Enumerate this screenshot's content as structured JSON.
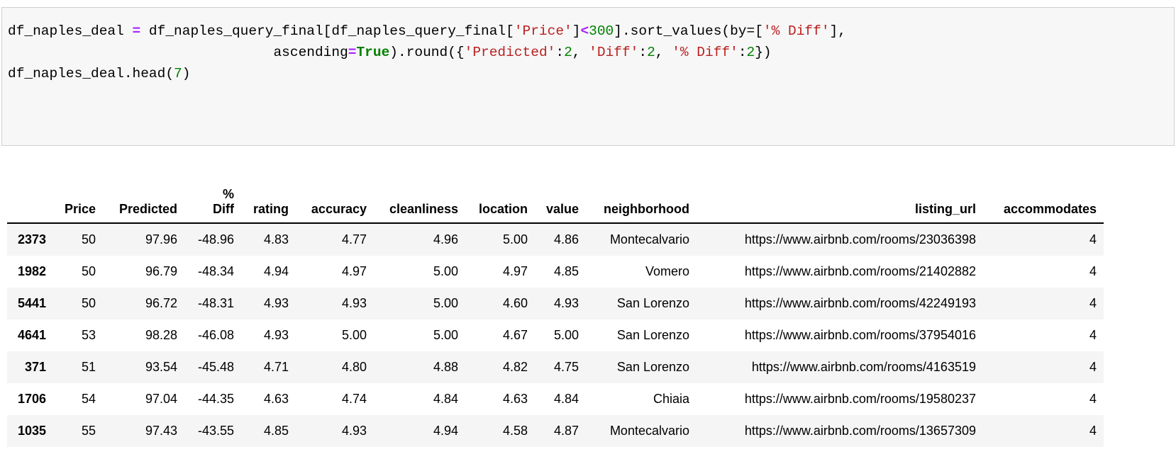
{
  "code_cell": {
    "line1": {
      "a": "df_naples_deal ",
      "op": "=",
      "b": " df_naples_query_final[df_naples_query_final[",
      "s1": "'Price'",
      "c": "]",
      "op2": "<",
      "n": "300",
      "d": "].sort_values(by=[",
      "s2": "'% Diff'",
      "e": "],"
    },
    "line2": {
      "a": "                                ascending",
      "op": "=",
      "kw": "True",
      "b": ").round({",
      "s1": "'Predicted'",
      "c": ":",
      "n1": "2",
      ", ": "",
      "d": ", ",
      "s2": "'Diff'",
      "e": ":",
      "n2": "2",
      "f": ", ",
      "s3": "'% Diff'",
      "g": ":",
      "n3": "2",
      "h": "})"
    },
    "line3": {
      "a": "df_naples_deal.head(",
      "n": "7",
      "b": ")"
    }
  },
  "table": {
    "columns": [
      "",
      "Price",
      "Predicted",
      "%\nDiff",
      "rating",
      "accuracy",
      "cleanliness",
      "location",
      "value",
      "neighborhood",
      "listing_url",
      "accommodates"
    ],
    "rows": [
      [
        "2373",
        "50",
        "97.96",
        "-48.96",
        "4.83",
        "4.77",
        "4.96",
        "5.00",
        "4.86",
        "Montecalvario",
        "https://www.airbnb.com/rooms/23036398",
        "4"
      ],
      [
        "1982",
        "50",
        "96.79",
        "-48.34",
        "4.94",
        "4.97",
        "5.00",
        "4.97",
        "4.85",
        "Vomero",
        "https://www.airbnb.com/rooms/21402882",
        "4"
      ],
      [
        "5441",
        "50",
        "96.72",
        "-48.31",
        "4.93",
        "4.93",
        "5.00",
        "4.60",
        "4.93",
        "San Lorenzo",
        "https://www.airbnb.com/rooms/42249193",
        "4"
      ],
      [
        "4641",
        "53",
        "98.28",
        "-46.08",
        "4.93",
        "5.00",
        "5.00",
        "4.67",
        "5.00",
        "San Lorenzo",
        "https://www.airbnb.com/rooms/37954016",
        "4"
      ],
      [
        "371",
        "51",
        "93.54",
        "-45.48",
        "4.71",
        "4.80",
        "4.88",
        "4.82",
        "4.75",
        "San Lorenzo",
        "https://www.airbnb.com/rooms/4163519",
        "4"
      ],
      [
        "1706",
        "54",
        "97.04",
        "-44.35",
        "4.63",
        "4.74",
        "4.84",
        "4.63",
        "4.84",
        "Chiaia",
        "https://www.airbnb.com/rooms/19580237",
        "4"
      ],
      [
        "1035",
        "55",
        "97.43",
        "-43.55",
        "4.85",
        "4.93",
        "4.94",
        "4.58",
        "4.87",
        "Montecalvario",
        "https://www.airbnb.com/rooms/13657309",
        "4"
      ]
    ]
  }
}
